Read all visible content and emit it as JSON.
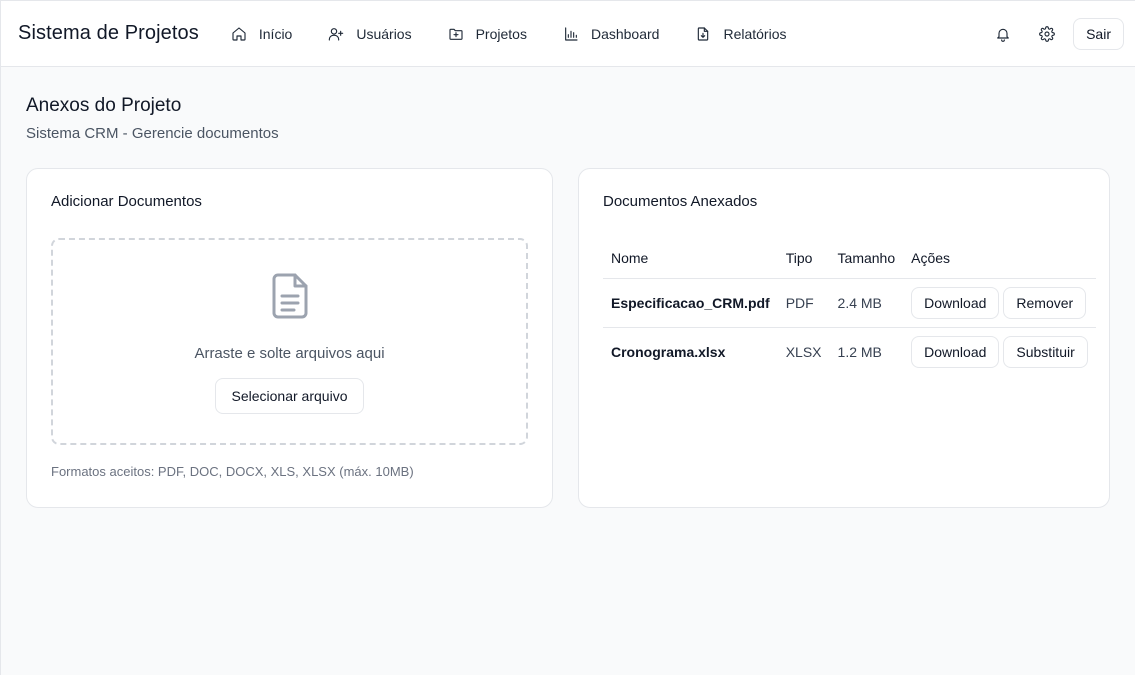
{
  "header": {
    "brand": "Sistema de Projetos",
    "nav": [
      {
        "label": "Início",
        "icon": "home-icon"
      },
      {
        "label": "Usuários",
        "icon": "user-plus-icon"
      },
      {
        "label": "Projetos",
        "icon": "folder-plus-icon"
      },
      {
        "label": "Dashboard",
        "icon": "bar-chart-icon"
      },
      {
        "label": "Relatórios",
        "icon": "file-download-icon"
      }
    ],
    "logout_label": "Sair"
  },
  "page": {
    "title": "Anexos do Projeto",
    "subtitle": "Sistema CRM - Gerencie documentos"
  },
  "upload": {
    "title": "Adicionar Documentos",
    "drop_text": "Arraste e solte arquivos aqui",
    "select_label": "Selecionar arquivo",
    "formats": "Formatos aceitos: PDF, DOC, DOCX, XLS, XLSX (máx. 10MB)"
  },
  "documents": {
    "title": "Documentos Anexados",
    "columns": [
      "Nome",
      "Tipo",
      "Tamanho",
      "Ações"
    ],
    "rows": [
      {
        "name": "Especificacao_CRM.pdf",
        "type": "PDF",
        "size": "2.4 MB",
        "actions": [
          "Download",
          "Remover"
        ]
      },
      {
        "name": "Cronograma.xlsx",
        "type": "XLSX",
        "size": "1.2 MB",
        "actions": [
          "Download",
          "Substituir"
        ]
      }
    ]
  },
  "colors": {
    "background": "#f9fafb",
    "border": "#e5e7eb",
    "text": "#111827",
    "muted": "#4b5563"
  }
}
